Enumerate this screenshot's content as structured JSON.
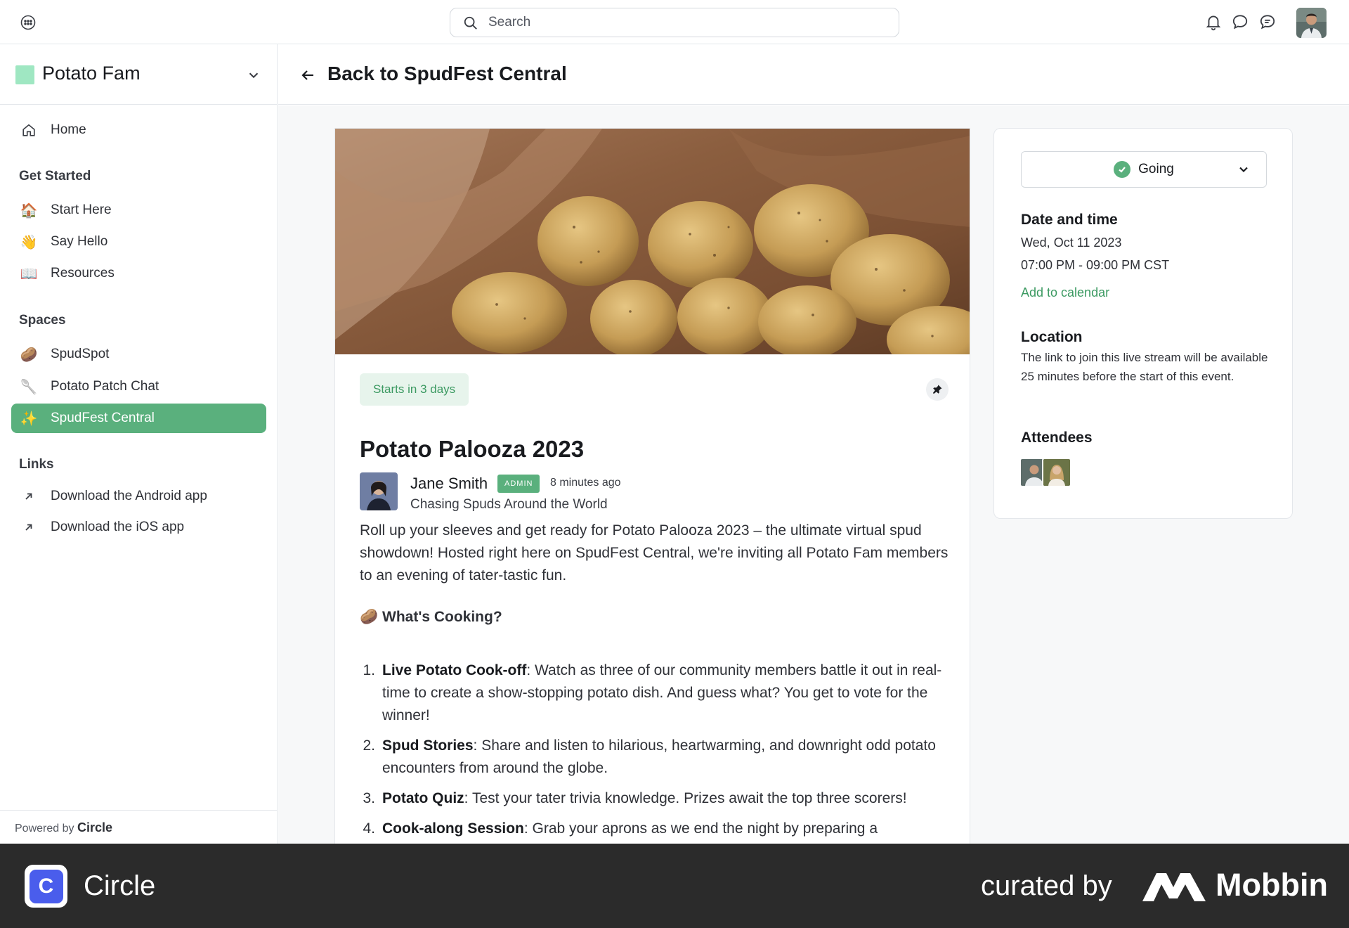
{
  "topbar": {
    "search_placeholder": "Search",
    "icons": [
      "menu-icon",
      "search-icon",
      "bell-icon",
      "chat-bubble-icon",
      "messages-icon"
    ]
  },
  "sidebar": {
    "community_name": "Potato Fam",
    "community_color": "#9fe7c2",
    "home_label": "Home",
    "get_started_heading": "Get Started",
    "get_started": [
      {
        "emoji": "🏠",
        "label": "Start Here"
      },
      {
        "emoji": "👋",
        "label": "Say Hello"
      },
      {
        "emoji": "📖",
        "label": "Resources"
      }
    ],
    "spaces_heading": "Spaces",
    "spaces": [
      {
        "emoji": "🥔",
        "label": "SpudSpot"
      },
      {
        "emoji": "🥄",
        "label": "Potato Patch Chat"
      },
      {
        "emoji": "✨",
        "label": "SpudFest Central",
        "active": true
      }
    ],
    "links_heading": "Links",
    "links": [
      {
        "label": "Download the Android app"
      },
      {
        "label": "Download the iOS app"
      }
    ],
    "powered_prefix": "Powered by",
    "powered_brand": "Circle",
    "accent_color": "#5ab07d"
  },
  "main": {
    "back_label": "Back to SpudFest Central",
    "starts_badge": "Starts in 3 days",
    "title": "Potato Palooza 2023",
    "author": {
      "name": "Jane Smith",
      "role_badge": "ADMIN",
      "posted": "8 minutes ago",
      "headline": "Chasing Spuds Around the World"
    },
    "intro": "Roll up your sleeves and get ready for Potato Palooza 2023 – the ultimate virtual spud showdown! Hosted right here on SpudFest Central, we're inviting all Potato Fam members to an evening of tater-tastic fun.",
    "section_emoji": "🥔",
    "section_heading": "What's Cooking?",
    "items": [
      {
        "num": "1.",
        "title": "Live Potato Cook-off",
        "text": ": Watch as three of our community members battle it out in real-time to create a show-stopping potato dish. And guess what? You get to vote for the winner!"
      },
      {
        "num": "2.",
        "title": "Spud Stories",
        "text": ": Share and listen to hilarious, heartwarming, and downright odd potato encounters from around the globe."
      },
      {
        "num": "3.",
        "title": "Potato Quiz",
        "text": ": Test your tater trivia knowledge. Prizes await the top three scorers!"
      },
      {
        "num": "4.",
        "title": "Cook-along Session",
        "text": ": Grab your aprons as we end the night by preparing a"
      }
    ]
  },
  "event": {
    "rsvp_label": "Going",
    "date_heading": "Date and time",
    "date": "Wed, Oct 11 2023",
    "time": "07:00 PM - 09:00 PM CST",
    "add_calendar": "Add to calendar",
    "location_heading": "Location",
    "location_text": "The link to join this live stream will be available 25 minutes before the start of this event.",
    "attendees_heading": "Attendees"
  },
  "footer": {
    "app_name": "Circle",
    "app_icon_letter": "C",
    "curated_by": "curated by",
    "brand": "Mobbin"
  }
}
